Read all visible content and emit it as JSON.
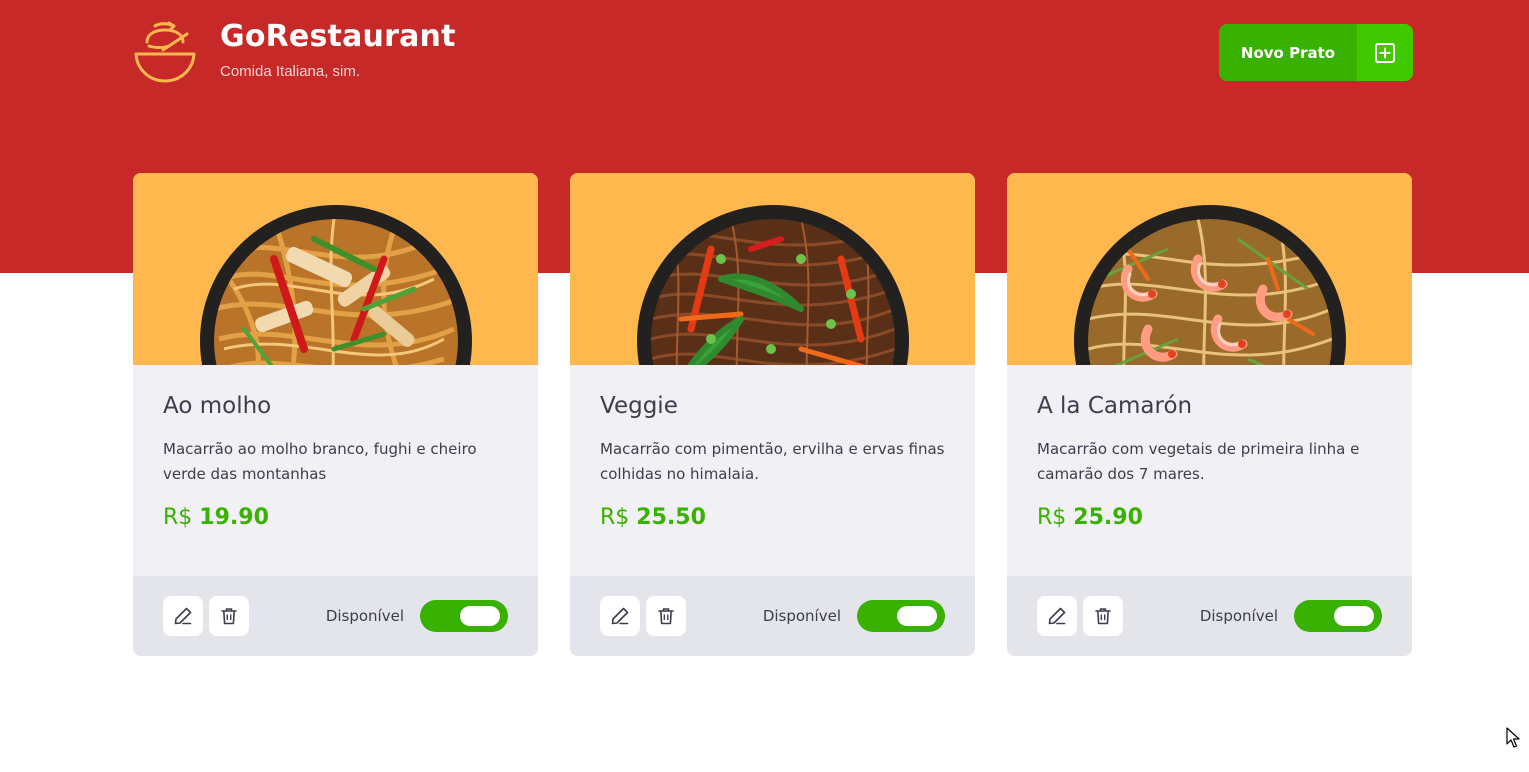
{
  "header": {
    "title": "GoRestaurant",
    "subtitle": "Comida Italiana, sim.",
    "new_button_label": "Novo Prato",
    "background_color": "#c72828",
    "icons": {
      "logo": "bowl-icon",
      "new_button": "plus-square-icon"
    }
  },
  "foods": [
    {
      "name": "Ao molho",
      "description": "Macarrão ao molho branco, fughi e cheiro verde das montanhas",
      "currency": "R$",
      "price": "19.90",
      "available_label": "Disponível",
      "available": true,
      "image_icon": "noodles-chicken-image"
    },
    {
      "name": "Veggie",
      "description": "Macarrão com pimentão, ervilha e ervas finas colhidas no himalaia.",
      "currency": "R$",
      "price": "25.50",
      "available_label": "Disponível",
      "available": true,
      "image_icon": "noodles-veggie-image"
    },
    {
      "name": "A la Camarón",
      "description": "Macarrão com vegetais de primeira linha e camarão dos 7 mares.",
      "currency": "R$",
      "price": "25.90",
      "available_label": "Disponível",
      "available": true,
      "image_icon": "noodles-shrimp-image"
    }
  ],
  "colors": {
    "accent_green": "#39b100",
    "card_image_bg": "#ffb84d",
    "card_body_bg": "#f0f0f5",
    "card_footer_bg": "#e4e4eb"
  }
}
